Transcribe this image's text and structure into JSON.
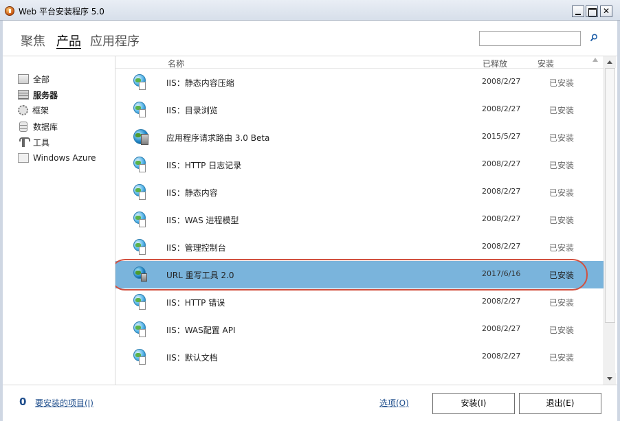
{
  "window": {
    "title": "Web 平台安装程序 5.0"
  },
  "nav": {
    "tabs": [
      "聚焦",
      "产品",
      "应用程序"
    ],
    "active": "产品",
    "search_placeholder": ""
  },
  "sidebar": {
    "items": [
      {
        "label": "全部",
        "icon": "folder-icon",
        "active": false
      },
      {
        "label": "服务器",
        "icon": "server-icon",
        "active": true
      },
      {
        "label": "框架",
        "icon": "gear-icon",
        "active": false
      },
      {
        "label": "数据库",
        "icon": "database-icon",
        "active": false
      },
      {
        "label": "工具",
        "icon": "tool-icon",
        "active": false
      },
      {
        "label": "Windows Azure",
        "icon": "folder-icon",
        "active": false
      }
    ]
  },
  "list": {
    "columns": {
      "name": "名称",
      "date": "已释放",
      "install": "安装"
    },
    "rows": [
      {
        "name": "IIS：静态内容压缩",
        "date": "2008/2/27",
        "status": "已安装",
        "icon": "iis-globe-icon"
      },
      {
        "name": "IIS：目录浏览",
        "date": "2008/2/27",
        "status": "已安装",
        "icon": "iis-globe-icon"
      },
      {
        "name": "应用程序请求路由 3.0 Beta",
        "date": "2015/5/27",
        "status": "已安装",
        "icon": "arr-globe-server-icon"
      },
      {
        "name": "IIS：HTTP 日志记录",
        "date": "2008/2/27",
        "status": "已安装",
        "icon": "iis-globe-icon"
      },
      {
        "name": "IIS：静态内容",
        "date": "2008/2/27",
        "status": "已安装",
        "icon": "iis-globe-icon"
      },
      {
        "name": "IIS：WAS 进程模型",
        "date": "2008/2/27",
        "status": "已安装",
        "icon": "iis-globe-icon"
      },
      {
        "name": "IIS：管理控制台",
        "date": "2008/2/27",
        "status": "已安装",
        "icon": "iis-globe-icon"
      },
      {
        "name": "URL 重写工具 2.0",
        "date": "2017/6/16",
        "status": "已安装",
        "icon": "url-rewrite-icon",
        "selected": true
      },
      {
        "name": "IIS：HTTP 错误",
        "date": "2008/2/27",
        "status": "已安装",
        "icon": "iis-globe-icon"
      },
      {
        "name": "IIS：WAS配置 API",
        "date": "2008/2/27",
        "status": "已安装",
        "icon": "iis-globe-icon"
      },
      {
        "name": "IIS：默认文档",
        "date": "2008/2/27",
        "status": "已安装",
        "icon": "iis-globe-icon"
      }
    ]
  },
  "footer": {
    "count": "0",
    "items_link": "要安装的项目(I)",
    "options_link": "选项(O)",
    "install_button": "安装(I)",
    "exit_button": "退出(E)"
  },
  "colors": {
    "selected_row": "#7ab4dc",
    "highlight_oval": "#d2503f",
    "link": "#1f4e8c"
  }
}
